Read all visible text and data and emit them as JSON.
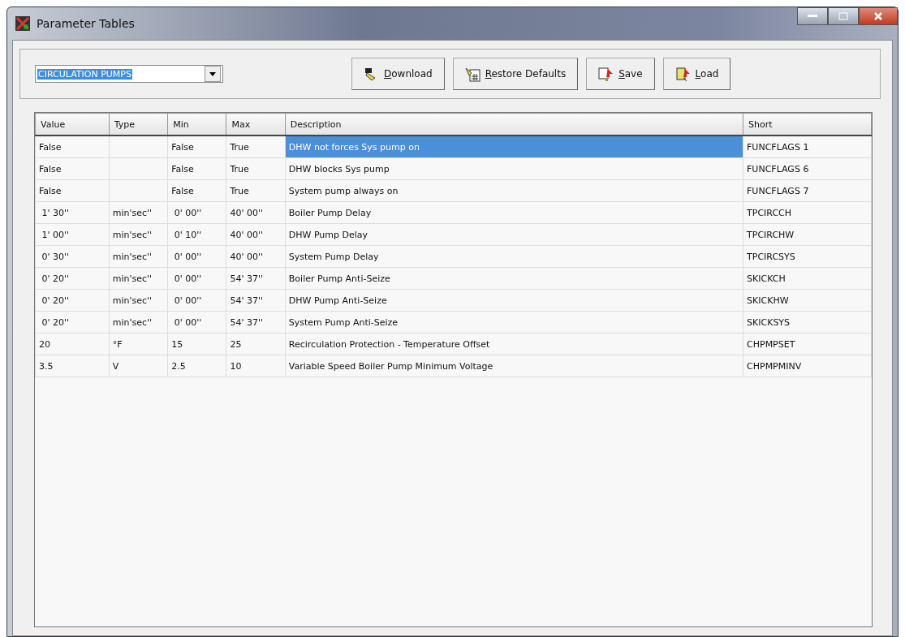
{
  "window": {
    "title": "Parameter Tables"
  },
  "table_selector": {
    "value": "CIRCULATION PUMPS"
  },
  "buttons": [
    {
      "label": "Download",
      "kind": "download"
    },
    {
      "label": "Restore Defaults",
      "kind": "restore"
    },
    {
      "label": "Save",
      "kind": "save"
    },
    {
      "label": "Load",
      "kind": "load"
    }
  ],
  "table": {
    "columns": [
      "Value",
      "Type",
      "Min",
      "Max",
      "Description",
      "Short"
    ],
    "rows": [
      {
        "cells": [
          "False",
          "",
          "False",
          "True",
          "DHW not forces Sys pump on",
          "FUNCFLAGS 1"
        ],
        "selected": true
      },
      {
        "cells": [
          "False",
          "",
          "False",
          "True",
          "DHW blocks Sys pump",
          "FUNCFLAGS 6"
        ],
        "selected": false
      },
      {
        "cells": [
          "False",
          "",
          "False",
          "True",
          "System pump always on",
          "FUNCFLAGS 7"
        ],
        "selected": false
      },
      {
        "cells": [
          " 1' 30''",
          "min'sec''",
          " 0' 00''",
          "40' 00''",
          "Boiler Pump Delay",
          "TPCIRCCH"
        ],
        "selected": false
      },
      {
        "cells": [
          " 1' 00''",
          "min'sec''",
          " 0' 10''",
          "40' 00''",
          "DHW Pump Delay",
          "TPCIRCHW"
        ],
        "selected": false
      },
      {
        "cells": [
          " 0' 30''",
          "min'sec''",
          " 0' 00''",
          "40' 00''",
          "System Pump Delay",
          "TPCIRCSYS"
        ],
        "selected": false
      },
      {
        "cells": [
          " 0' 20''",
          "min'sec''",
          " 0' 00''",
          "54' 37''",
          "Boiler Pump Anti-Seize",
          "SKICKCH"
        ],
        "selected": false
      },
      {
        "cells": [
          " 0' 20''",
          "min'sec''",
          " 0' 00''",
          "54' 37''",
          "DHW Pump Anti-Seize",
          "SKICKHW"
        ],
        "selected": false
      },
      {
        "cells": [
          " 0' 20''",
          "min'sec''",
          " 0' 00''",
          "54' 37''",
          "System Pump Anti-Seize",
          "SKICKSYS"
        ],
        "selected": false
      },
      {
        "cells": [
          "20",
          "°F",
          "15",
          "25",
          "Recirculation Protection - Temperature Offset",
          "CHPMPSET"
        ],
        "selected": false
      },
      {
        "cells": [
          "3.5",
          "V",
          "2.5",
          "10",
          "Variable Speed Boiler Pump Minimum Voltage",
          "CHPMPMINV"
        ],
        "selected": false
      }
    ]
  }
}
